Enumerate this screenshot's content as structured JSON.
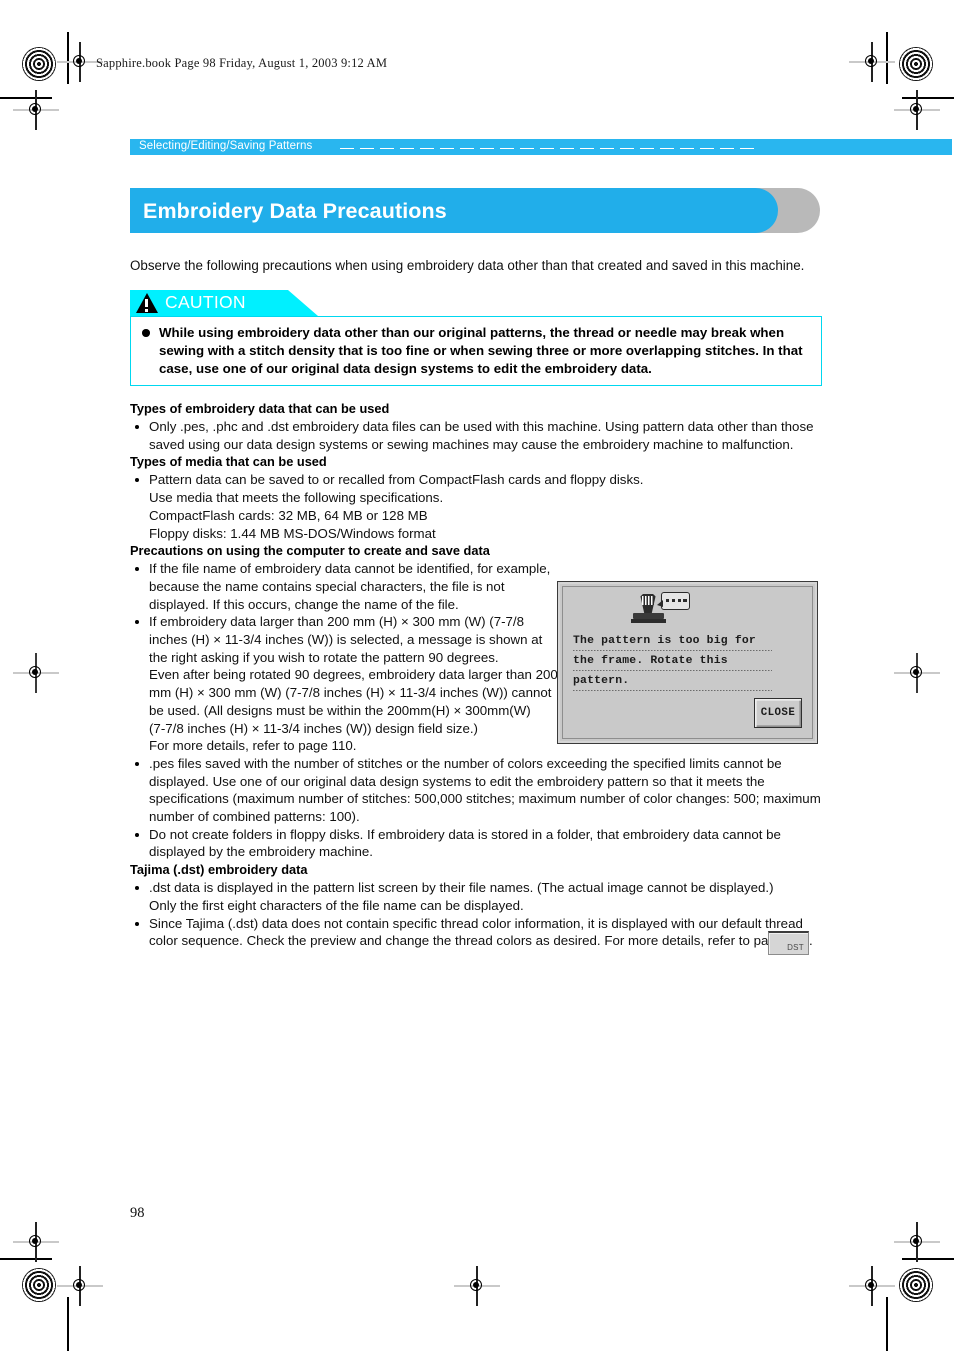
{
  "print_marks": {
    "file_stamp": "Sapphire.book  Page 98  Friday, August 1, 2003  9:12 AM"
  },
  "header": {
    "running_head": "Selecting/Editing/Saving Patterns"
  },
  "title": {
    "text": "Embroidery Data Precautions",
    "bar_color": "#21aeea",
    "shadow_color": "#b9b9b9"
  },
  "intro": "Observe the following precautions when using embroidery data other than that created and saved in this machine.",
  "caution": {
    "label": "CAUTION",
    "accent_color": "#00f0ff",
    "border_color": "#00d8f0",
    "items": [
      "While using embroidery data other than our original patterns, the thread or needle may break when sewing with a stitch density that is too fine or when sewing three or more overlapping stitches. In that case, use one of our original data design systems to edit the embroidery data."
    ]
  },
  "sections": [
    {
      "heading": "Types of embroidery data that can be used",
      "bullets": [
        {
          "main": "Only .pes, .phc and .dst embroidery data files can be used with this machine. Using pattern data other than those saved using our data design systems or sewing machines may cause the embroidery machine to malfunction.",
          "continuations": []
        }
      ]
    },
    {
      "heading": "Types of media that can be used",
      "bullets": [
        {
          "main": "Pattern data can be saved to or recalled from CompactFlash cards and floppy disks.",
          "continuations": [
            "Use media that meets the following specifications.",
            "CompactFlash cards: 32 MB, 64 MB or 128 MB",
            "Floppy disks: 1.44 MB MS-DOS/Windows format"
          ]
        }
      ]
    },
    {
      "heading": "Precautions on using the computer to create and save data",
      "bullets": [
        {
          "main": "If the file name of embroidery data cannot be identified, for example, because the name contains special characters, the file is not displayed. If this occurs, change the name of the file.",
          "continuations": []
        },
        {
          "main": "If embroidery data larger than 200 mm (H) × 300 mm (W) (7-7/8 inches (H) × 11-3/4 inches (W)) is selected, a message is shown at the right asking if you wish to rotate the pattern 90 degrees.",
          "continuations": [
            "Even after being rotated 90 degrees, embroidery data larger than 200 mm (H) × 300 mm (W) (7-7/8 inches (H) × 11-3/4 inches (W)) cannot be used. (All designs must be within the 200mm(H) × 300mm(W)",
            "(7-7/8 inches (H) × 11-3/4 inches (W)) design field size.)",
            "For more details, refer to page 110."
          ]
        },
        {
          "main": ".pes files saved with the number of stitches or the number of colors exceeding the specified limits cannot be displayed. Use one of our original data design systems to edit the embroidery pattern so that it meets the specifications (maximum number of stitches: 500,000 stitches; maximum number of color changes: 500; maximum number of combined patterns: 100).",
          "continuations": []
        },
        {
          "main": "Do not create folders in floppy disks. If embroidery data is stored in a folder, that embroidery data cannot be displayed by the embroidery machine.",
          "continuations": []
        }
      ]
    },
    {
      "heading": "Tajima (.dst) embroidery data",
      "bullets": [
        {
          "main": ".dst data is displayed in the pattern list screen by their file names. (The actual image cannot be displayed.) Only the first eight characters of the file name can be displayed.",
          "continuations": []
        },
        {
          "main": "Since Tajima (.dst) data does not contain specific thread color information, it is displayed with our default thread color sequence. Check the preview and change the thread colors as desired. For more details, refer to page 163.",
          "continuations": []
        }
      ]
    }
  ],
  "lcd_screen": {
    "message_lines": [
      "The pattern is too big for",
      "the frame. Rotate this",
      "pattern."
    ],
    "close_button": "CLOSE",
    "icon": "sewing-machine-with-speech-bubble"
  },
  "dst_key": {
    "label": "DST"
  },
  "folio": {
    "page_number": "98"
  }
}
